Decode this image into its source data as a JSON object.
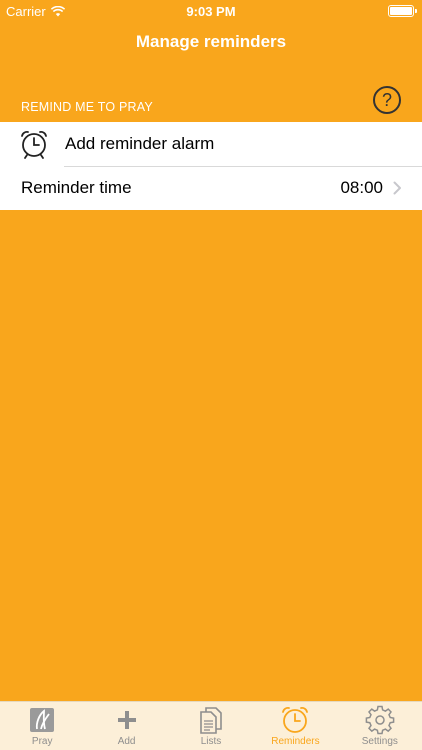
{
  "status_bar": {
    "carrier": "Carrier",
    "time": "9:03 PM"
  },
  "nav": {
    "title": "Manage reminders"
  },
  "section": {
    "header": "REMIND ME TO PRAY",
    "help_icon": "help-circle-icon"
  },
  "rows": [
    {
      "label": "Add reminder alarm",
      "icon": "alarm-clock-icon"
    },
    {
      "label": "Reminder time",
      "value": "08:00",
      "accessory": "chevron-right-icon"
    }
  ],
  "tabs": [
    {
      "label": "Pray",
      "icon": "praying-hands-icon"
    },
    {
      "label": "Add",
      "icon": "plus-icon"
    },
    {
      "label": "Lists",
      "icon": "document-list-icon"
    },
    {
      "label": "Reminders",
      "icon": "alarm-clock-icon",
      "active": true
    },
    {
      "label": "Settings",
      "icon": "gear-icon"
    }
  ],
  "colors": {
    "accent": "#F9A61C",
    "tab_bar_bg": "#FCEFD8",
    "inactive": "#8e8e8e"
  }
}
